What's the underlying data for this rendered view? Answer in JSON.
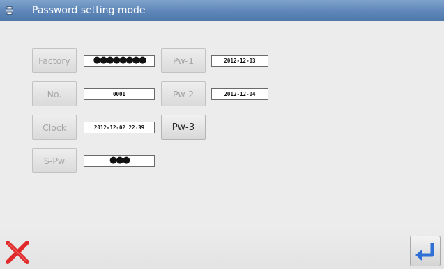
{
  "window": {
    "title": "Password setting mode",
    "icon": "printer-icon"
  },
  "fields": {
    "factory": {
      "label": "Factory",
      "value": "●●●●●●●●"
    },
    "no": {
      "label": "No.",
      "value": "0001"
    },
    "clock": {
      "label": "Clock",
      "value": "2012-12-02 22:39"
    },
    "spw": {
      "label": "S-Pw",
      "value": "●●●"
    },
    "pw1": {
      "label": "Pw-1",
      "value": "2012-12-03"
    },
    "pw2": {
      "label": "Pw-2",
      "value": "2012-12-04"
    },
    "pw3": {
      "label": "Pw-3"
    }
  },
  "footer": {
    "cancel_icon": "red-x-icon",
    "enter_icon": "enter-return-icon"
  },
  "colors": {
    "titlebar": "#5e86b8",
    "cancel": "#e02a2a",
    "enter": "#2f6fd6"
  }
}
